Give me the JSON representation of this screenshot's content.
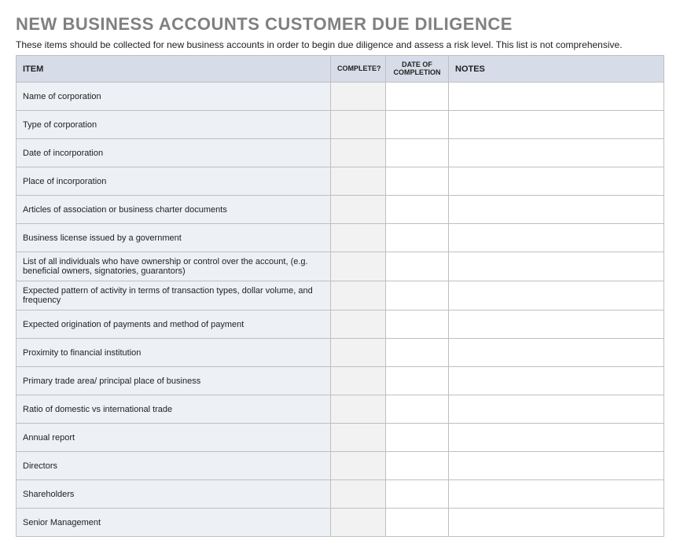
{
  "title": "NEW BUSINESS ACCOUNTS CUSTOMER DUE DILIGENCE",
  "subtitle": "These items should be collected for new business accounts in order to begin due diligence and assess a risk level. This list is not comprehensive.",
  "columns": {
    "item": "ITEM",
    "complete": "COMPLETE?",
    "date": "DATE OF COMPLETION",
    "notes": "NOTES"
  },
  "rows": [
    {
      "item": "Name of corporation",
      "complete": "",
      "date": "",
      "notes": ""
    },
    {
      "item": "Type of corporation",
      "complete": "",
      "date": "",
      "notes": ""
    },
    {
      "item": "Date of incorporation",
      "complete": "",
      "date": "",
      "notes": ""
    },
    {
      "item": "Place of incorporation",
      "complete": "",
      "date": "",
      "notes": ""
    },
    {
      "item": "Articles of association or business charter documents",
      "complete": "",
      "date": "",
      "notes": ""
    },
    {
      "item": "Business license issued by a government",
      "complete": "",
      "date": "",
      "notes": ""
    },
    {
      "item": "List of all individuals who have ownership or control over the account, (e.g. beneficial owners, signatories, guarantors)",
      "complete": "",
      "date": "",
      "notes": ""
    },
    {
      "item": "Expected pattern of activity in terms of transaction types, dollar volume, and frequency",
      "complete": "",
      "date": "",
      "notes": ""
    },
    {
      "item": "Expected origination of payments and method of payment",
      "complete": "",
      "date": "",
      "notes": ""
    },
    {
      "item": "Proximity to financial institution",
      "complete": "",
      "date": "",
      "notes": ""
    },
    {
      "item": "Primary trade area/ principal place of business",
      "complete": "",
      "date": "",
      "notes": ""
    },
    {
      "item": "Ratio of domestic vs international trade",
      "complete": "",
      "date": "",
      "notes": ""
    },
    {
      "item": "Annual report",
      "complete": "",
      "date": "",
      "notes": ""
    },
    {
      "item": "Directors",
      "complete": "",
      "date": "",
      "notes": ""
    },
    {
      "item": "Shareholders",
      "complete": "",
      "date": "",
      "notes": ""
    },
    {
      "item": "Senior Management",
      "complete": "",
      "date": "",
      "notes": ""
    }
  ]
}
